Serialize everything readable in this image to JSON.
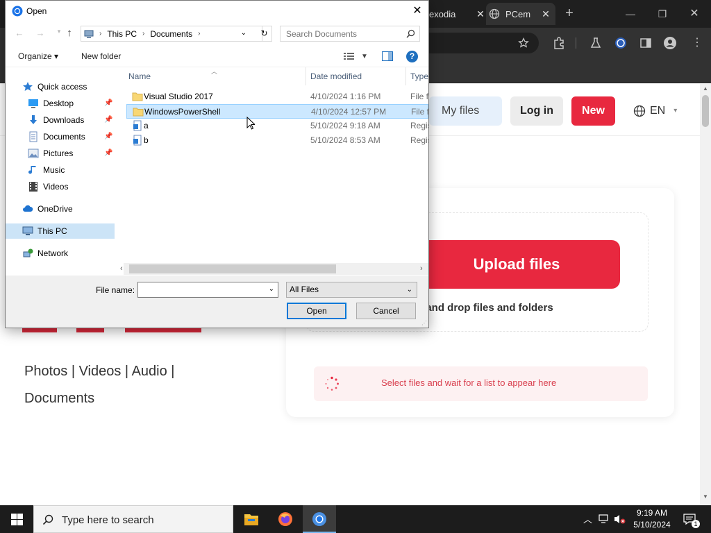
{
  "browser": {
    "tabs": [
      {
        "label": "exodia",
        "close": "✕"
      },
      {
        "label": "PCem",
        "close": "✕"
      }
    ],
    "new_tab": "+",
    "window": {
      "minimize": "—",
      "restore": "❐",
      "close": "✕"
    }
  },
  "site": {
    "my_files": "My files",
    "login": "Log in",
    "new": "New",
    "lang": "EN",
    "upload_button": "Upload files",
    "drop_hint": "g and drop files and folders",
    "status": "Select files and wait for a list to appear here",
    "links_line1": "Photos  |  Videos  |  Audio  |",
    "links_line2": "Documents"
  },
  "dialog": {
    "title": "Open",
    "close": "✕",
    "breadcrumb": [
      "This PC",
      "Documents"
    ],
    "search_placeholder": "Search Documents",
    "organize": "Organize ▾",
    "new_folder": "New folder",
    "help": "?",
    "nav": {
      "quick_access": "Quick access",
      "items": [
        {
          "label": "Desktop",
          "pinned": true
        },
        {
          "label": "Downloads",
          "pinned": true
        },
        {
          "label": "Documents",
          "pinned": true
        },
        {
          "label": "Pictures",
          "pinned": true
        },
        {
          "label": "Music",
          "pinned": false
        },
        {
          "label": "Videos",
          "pinned": false
        }
      ],
      "onedrive": "OneDrive",
      "this_pc": "This PC",
      "network": "Network"
    },
    "columns": [
      "Name",
      "Date modified",
      "Type"
    ],
    "files": [
      {
        "name": "Visual Studio 2017",
        "date": "4/10/2024 1:16 PM",
        "type": "File folder",
        "kind": "folder"
      },
      {
        "name": "WindowsPowerShell",
        "date": "4/10/2024 12:57 PM",
        "type": "File folder",
        "kind": "folder",
        "selected": true
      },
      {
        "name": "a",
        "date": "5/10/2024 9:18 AM",
        "type": "Registration Entries",
        "kind": "reg"
      },
      {
        "name": "b",
        "date": "5/10/2024 8:53 AM",
        "type": "Registration Entries",
        "kind": "reg"
      }
    ],
    "file_name_label": "File name:",
    "file_name_value": "",
    "file_type": "All Files",
    "open_button": "Open",
    "cancel_button": "Cancel"
  },
  "taskbar": {
    "search_placeholder": "Type here to search",
    "time": "9:19 AM",
    "date": "5/10/2024",
    "notification_count": "1"
  },
  "colors": {
    "accent": "#e8283f",
    "selection": "#cce8ff",
    "chrome_dark": "#323232"
  }
}
